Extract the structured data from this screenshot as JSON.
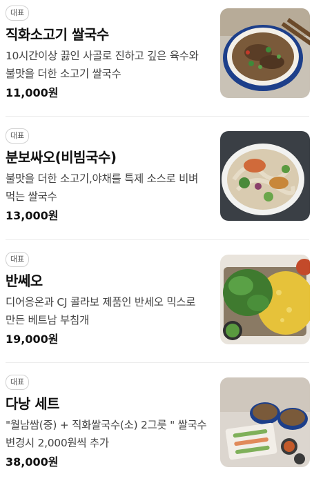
{
  "menu": {
    "items": [
      {
        "badge": "대표",
        "name": "직화소고기 쌀국수",
        "description": "10시간이상 끓인 사골로 진하고 깊은 육수와 불맛을 더한 소고기 쌀국수",
        "price": "11,000원",
        "image": "beef-pho-photo"
      },
      {
        "badge": "대표",
        "name": "분보싸오(비빔국수)",
        "description": "불맛을 더한 소고기,야채를 특제 소스로 비벼먹는 쌀국수",
        "price": "13,000원",
        "image": "bun-bo-xao-photo"
      },
      {
        "badge": "대표",
        "name": "반쎄오",
        "description": "디어응온과 CJ 콜라보 제품인 반세오 믹스로 만든 베트남 부침개",
        "price": "19,000원",
        "image": "banh-xeo-photo"
      },
      {
        "badge": "대표",
        "name": "다낭 세트",
        "description": "\"월남쌈(중) + 직화쌀국수(소) 2그릇 \" 쌀국수변경시 2,000원씩 추가",
        "price": "38,000원",
        "image": "danang-set-photo"
      }
    ]
  }
}
